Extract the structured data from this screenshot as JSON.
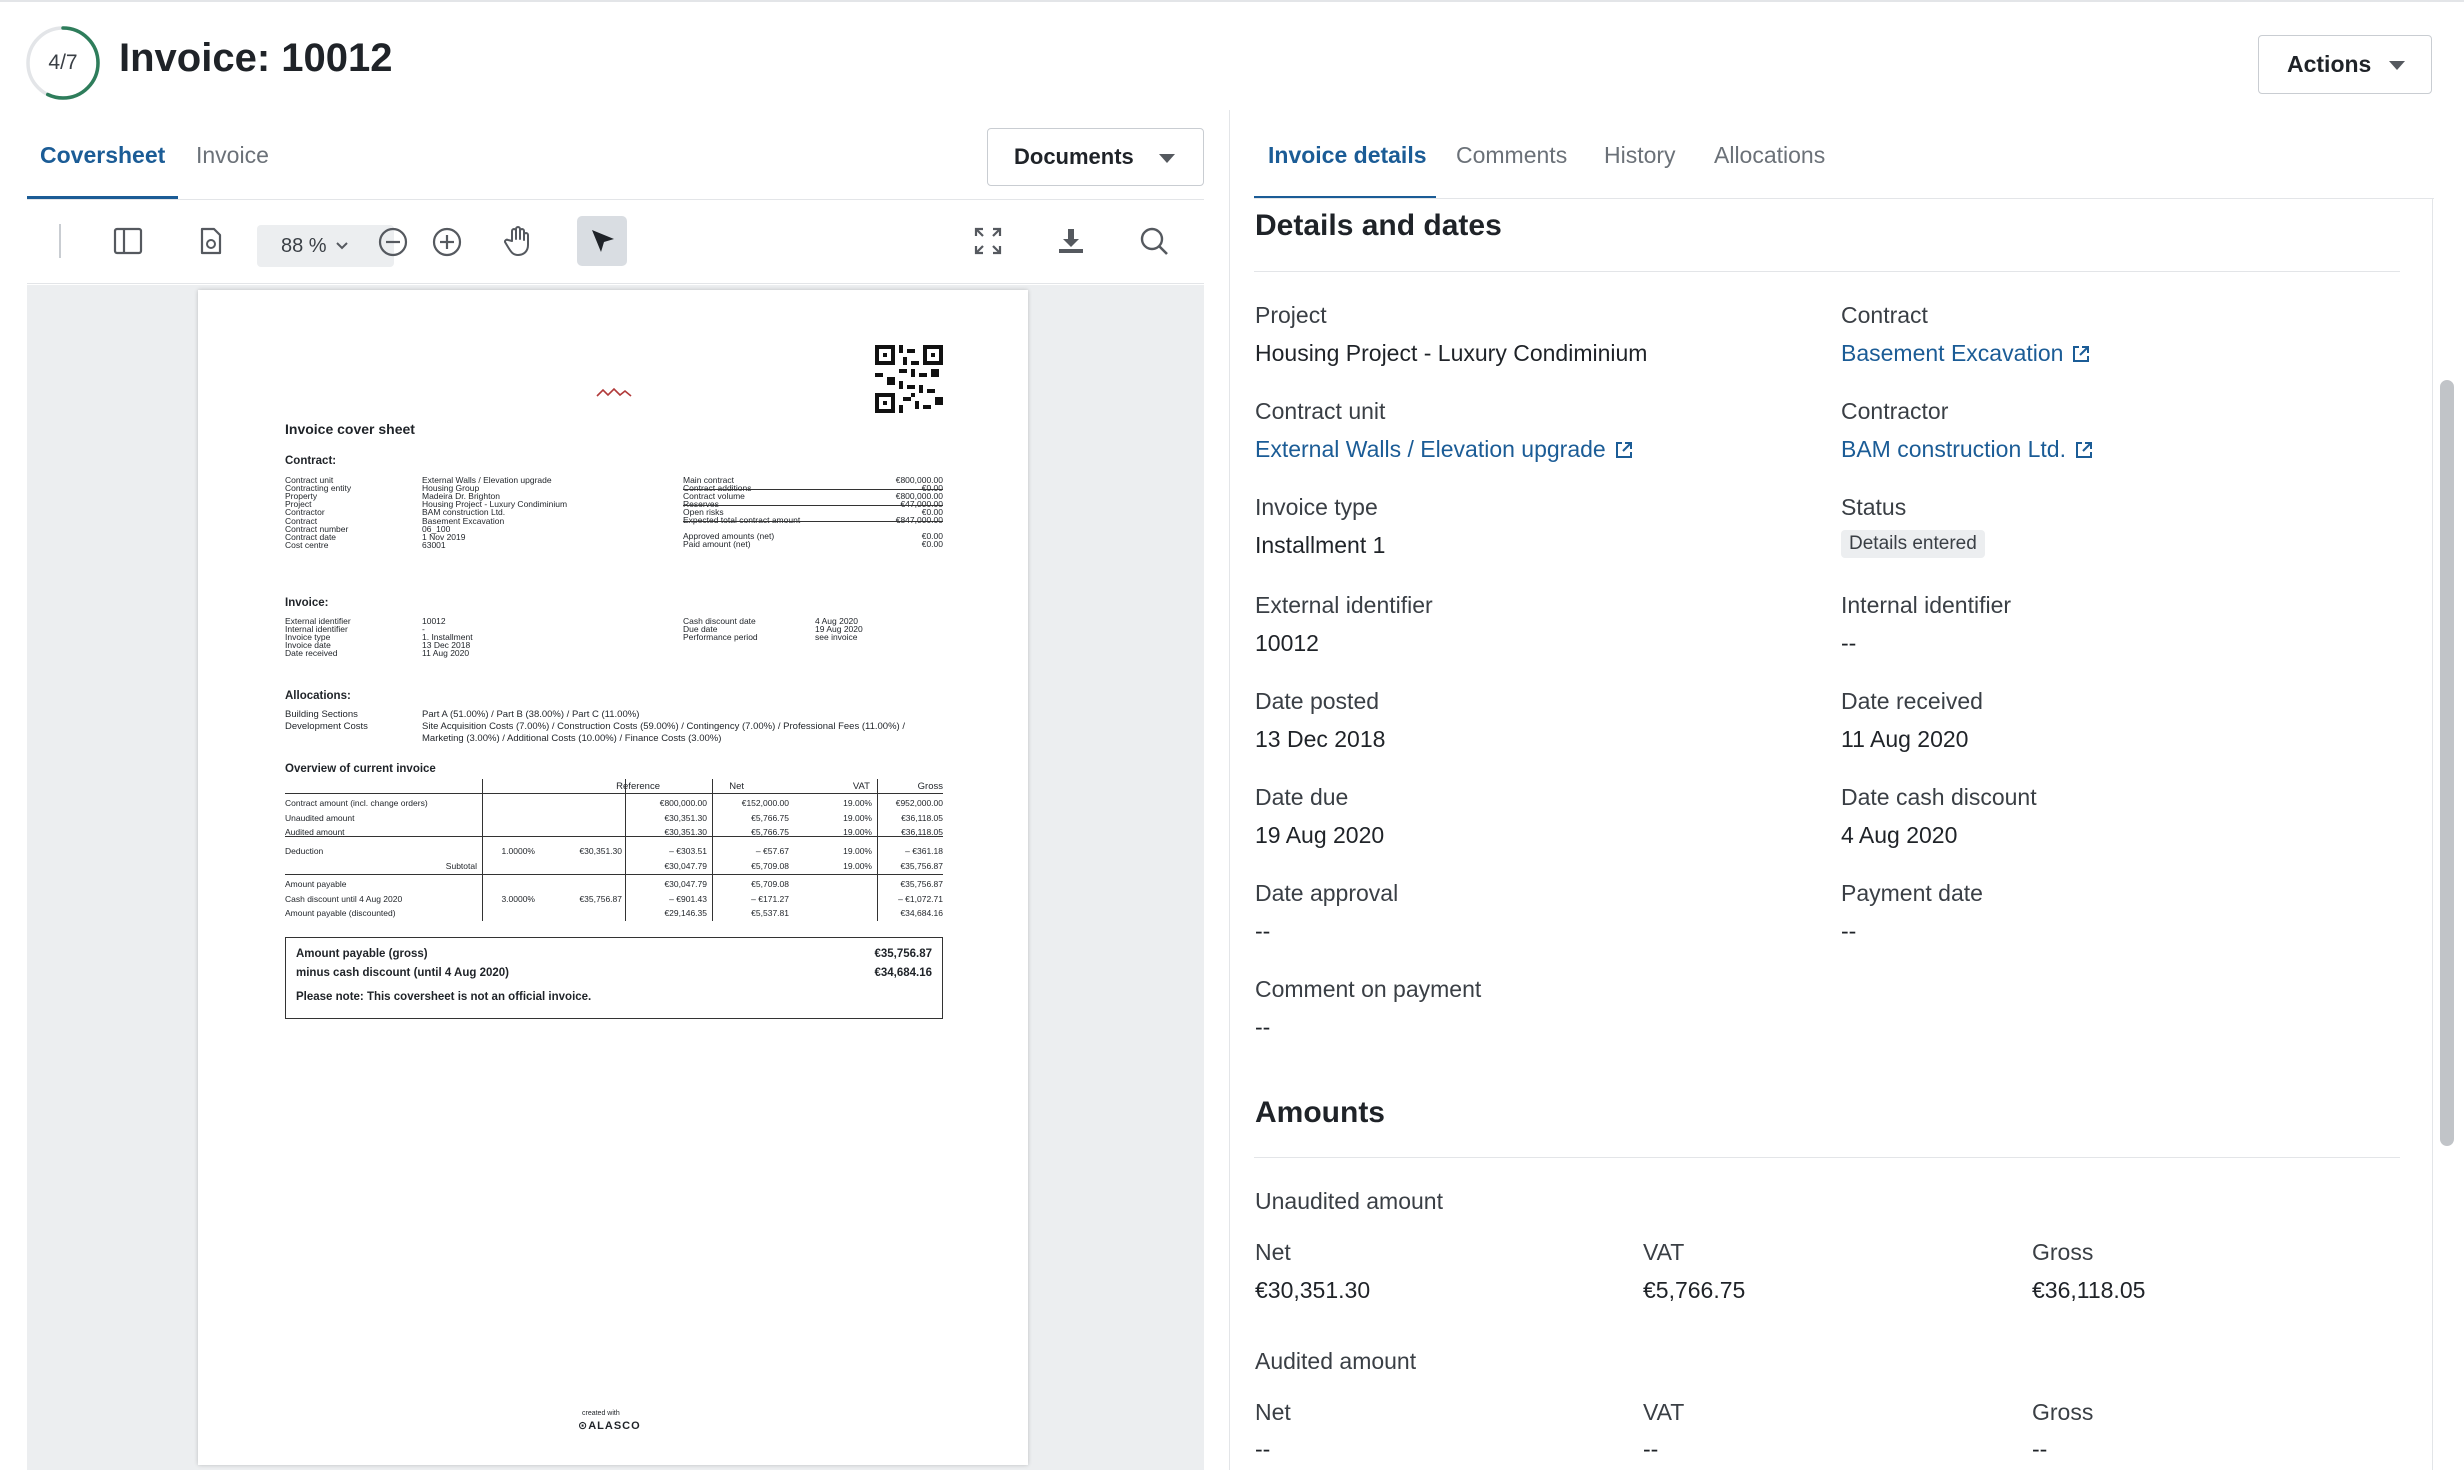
{
  "header": {
    "progress": "4/7",
    "progress_fraction": 0.571,
    "title": "Invoice: 10012",
    "actions_label": "Actions"
  },
  "left_tabs": [
    {
      "label": "Coversheet",
      "active": true
    },
    {
      "label": "Invoice",
      "active": false
    }
  ],
  "documents_label": "Documents",
  "viewer": {
    "zoom": "88 %",
    "tools": [
      "sidebar-toggle-icon",
      "document-settings-icon",
      "zoom-out-icon",
      "zoom-in-icon",
      "hand-tool-icon",
      "select-arrow-icon",
      "fullscreen-icon",
      "download-icon",
      "search-icon"
    ]
  },
  "pdf": {
    "heading": "Invoice cover sheet",
    "contract_heading": "Contract:",
    "contract_rows": [
      {
        "label": "Contract unit",
        "value": "External Walls / Elevation upgrade"
      },
      {
        "label": "Contracting entity",
        "value": "Housing Group"
      },
      {
        "label": "Property",
        "value": "Madeira Dr. Brighton"
      },
      {
        "label": "Project",
        "value": "Housing Project - Luxury Condiminium"
      },
      {
        "label": "Contractor",
        "value": "BAM construction Ltd."
      },
      {
        "label": "Contract",
        "value": "Basement Excavation"
      },
      {
        "label": "Contract number",
        "value": "06_100"
      },
      {
        "label": "Contract date",
        "value": "1 Nov 2019"
      },
      {
        "label": "Cost centre",
        "value": "63001"
      }
    ],
    "contract_amounts": [
      {
        "label": "Main contract",
        "value": "€800,000.00"
      },
      {
        "label": "Contract additions",
        "value": "€0.00"
      },
      {
        "label": "Contract volume",
        "value": "€800,000.00"
      },
      {
        "label": "Reserves",
        "value": "€47,000.00"
      },
      {
        "label": "Open risks",
        "value": "€0.00"
      },
      {
        "label": "Expected total contract amount",
        "value": "€847,000.00"
      },
      {
        "label": "Approved amounts (net)",
        "value": "€0.00"
      },
      {
        "label": "Paid amount (net)",
        "value": "€0.00"
      }
    ],
    "invoice_heading": "Invoice:",
    "invoice_rows": [
      {
        "label": "External identifier",
        "value": "10012"
      },
      {
        "label": "Internal identifier",
        "value": "-"
      },
      {
        "label": "Invoice type",
        "value": "1. Installment"
      },
      {
        "label": "Invoice date",
        "value": "13 Dec 2018"
      },
      {
        "label": "Date received",
        "value": "11 Aug 2020"
      }
    ],
    "invoice_dates": [
      {
        "label": "Cash discount date",
        "value": "4 Aug 2020"
      },
      {
        "label": "Due date",
        "value": "19 Aug 2020"
      },
      {
        "label": "Performance period",
        "value": "see invoice"
      }
    ],
    "allocations_heading": "Allocations:",
    "allocations": [
      {
        "label": "Building Sections",
        "value": "Part A (51.00%) / Part B (38.00%) / Part C (11.00%)"
      },
      {
        "label": "Development Costs",
        "value": "Site Acquisition Costs (7.00%) / Construction Costs (59.00%) / Contingency (7.00%) / Professional Fees (11.00%) /",
        "value2": "Marketing (3.00%) / Additional Costs (10.00%) / Finance Costs (3.00%)"
      }
    ],
    "overview_heading": "Overview of current invoice",
    "table_headers": [
      "Reference",
      "Net",
      "VAT",
      "Gross"
    ],
    "table_rows": [
      {
        "label": "Contract amount (incl. change orders)",
        "pct": "",
        "ref": "",
        "net": "€800,000.00",
        "vatamt": "€152,000.00",
        "vat": "19.00%",
        "gross": "€952,000.00"
      },
      {
        "label": "Unaudited amount",
        "pct": "",
        "ref": "",
        "net": "€30,351.30",
        "vatamt": "€5,766.75",
        "vat": "19.00%",
        "gross": "€36,118.05"
      },
      {
        "label": "Audited amount",
        "pct": "",
        "ref": "",
        "net": "€30,351.30",
        "vatamt": "€5,766.75",
        "vat": "19.00%",
        "gross": "€36,118.05"
      },
      {
        "label": "Deduction",
        "pct": "1.0000%",
        "ref": "€30,351.30",
        "net": "– €303.51",
        "vatamt": "– €57.67",
        "vat": "19.00%",
        "gross": "– €361.18"
      },
      {
        "label": "Subtotal",
        "pct": "",
        "ref": "",
        "net": "€30,047.79",
        "vatamt": "€5,709.08",
        "vat": "19.00%",
        "gross": "€35,756.87"
      },
      {
        "label": "Amount payable",
        "pct": "",
        "ref": "",
        "net": "€30,047.79",
        "vatamt": "€5,709.08",
        "vat": "",
        "gross": "€35,756.87"
      },
      {
        "label": "Cash discount until 4 Aug 2020",
        "pct": "3.0000%",
        "ref": "€35,756.87",
        "net": "– €901.43",
        "vatamt": "– €171.27",
        "vat": "",
        "gross": "– €1,072.71"
      },
      {
        "label": "Amount payable (discounted)",
        "pct": "",
        "ref": "",
        "net": "€29,146.35",
        "vatamt": "€5,537.81",
        "vat": "",
        "gross": "€34,684.16"
      }
    ],
    "summary": {
      "gross_label": "Amount payable (gross)",
      "gross_value": "€35,756.87",
      "discount_label": "minus cash discount (until 4 Aug 2020)",
      "discount_value": "€34,684.16",
      "note": "Please note: This coversheet is not an official invoice."
    },
    "footer_small": "created with",
    "footer_brand": "ALASCO"
  },
  "right_tabs": [
    {
      "label": "Invoice details",
      "active": true
    },
    {
      "label": "Comments",
      "active": false
    },
    {
      "label": "History",
      "active": false
    },
    {
      "label": "Allocations",
      "active": false
    }
  ],
  "details": {
    "section_title": "Details and dates",
    "project_label": "Project",
    "project_value": "Housing Project - Luxury Condiminium",
    "contract_label": "Contract",
    "contract_value": "Basement Excavation",
    "contract_unit_label": "Contract unit",
    "contract_unit_value": "External Walls / Elevation upgrade",
    "contractor_label": "Contractor",
    "contractor_value": "BAM construction Ltd.",
    "invoice_type_label": "Invoice type",
    "invoice_type_value": "Installment 1",
    "status_label": "Status",
    "status_value": "Details entered",
    "external_id_label": "External identifier",
    "external_id_value": "10012",
    "internal_id_label": "Internal identifier",
    "internal_id_value": "--",
    "date_posted_label": "Date posted",
    "date_posted_value": "13 Dec 2018",
    "date_received_label": "Date received",
    "date_received_value": "11 Aug 2020",
    "date_due_label": "Date due",
    "date_due_value": "19 Aug 2020",
    "date_cash_discount_label": "Date cash discount",
    "date_cash_discount_value": "4 Aug 2020",
    "date_approval_label": "Date approval",
    "date_approval_value": "--",
    "payment_date_label": "Payment date",
    "payment_date_value": "--",
    "comment_label": "Comment on payment",
    "comment_value": "--"
  },
  "amounts": {
    "section_title": "Amounts",
    "unaudited_title": "Unaudited amount",
    "unaudited": {
      "net_label": "Net",
      "net": "€30,351.30",
      "vat_label": "VAT",
      "vat": "€5,766.75",
      "gross_label": "Gross",
      "gross": "€36,118.05"
    },
    "audited_title": "Audited amount",
    "audited": {
      "net_label": "Net",
      "net": "--",
      "vat_label": "VAT",
      "vat": "--",
      "gross_label": "Gross",
      "gross": "--"
    }
  },
  "colors": {
    "accent": "#1b5c96",
    "progress": "#2e7d5b"
  }
}
